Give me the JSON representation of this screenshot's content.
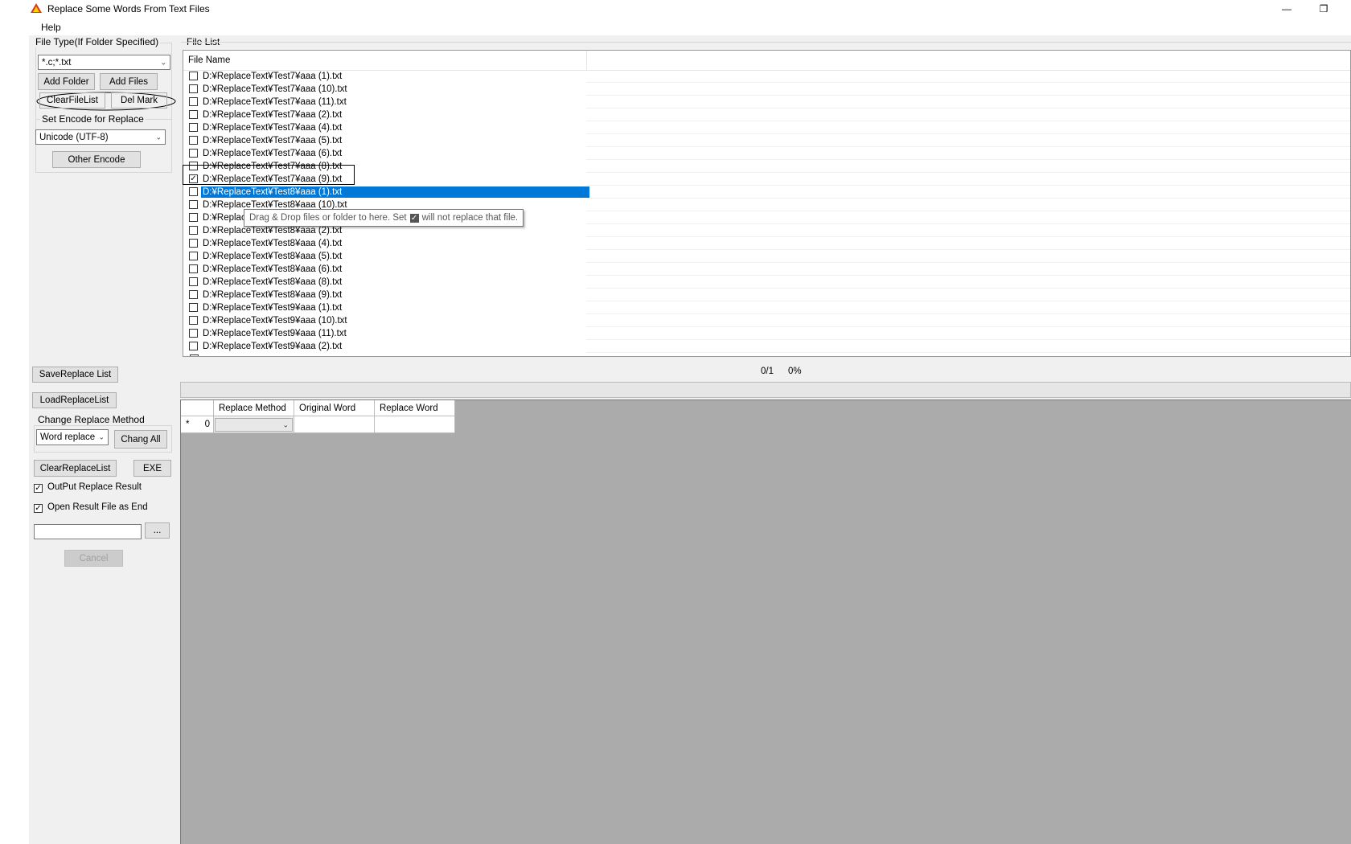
{
  "window": {
    "title": "Replace Some Words From Text Files",
    "minimize_glyph": "—",
    "restore_glyph": "❐"
  },
  "menu": {
    "help": "Help"
  },
  "left_panel": {
    "file_type_group": "File Type(If Folder Specified)",
    "file_type_value": "*.c;*.txt",
    "add_folder": "Add Folder",
    "add_files": "Add Files",
    "clear_file_list": "ClearFileList",
    "del_mark": "Del Mark",
    "encode_group": "Set Encode for Replace",
    "encode_value": "Unicode (UTF-8)",
    "other_encode": "Other Encode"
  },
  "file_list": {
    "group_label": "File List",
    "column_header": "File Name",
    "files": [
      {
        "name": "D:¥ReplaceText¥Test7¥aaa (1).txt",
        "checked": false
      },
      {
        "name": "D:¥ReplaceText¥Test7¥aaa (10).txt",
        "checked": false
      },
      {
        "name": "D:¥ReplaceText¥Test7¥aaa (11).txt",
        "checked": false
      },
      {
        "name": "D:¥ReplaceText¥Test7¥aaa (2).txt",
        "checked": false
      },
      {
        "name": "D:¥ReplaceText¥Test7¥aaa (4).txt",
        "checked": false
      },
      {
        "name": "D:¥ReplaceText¥Test7¥aaa (5).txt",
        "checked": false
      },
      {
        "name": "D:¥ReplaceText¥Test7¥aaa (6).txt",
        "checked": false
      },
      {
        "name": "D:¥ReplaceText¥Test7¥aaa (8).txt",
        "checked": false
      },
      {
        "name": "D:¥ReplaceText¥Test7¥aaa (9).txt",
        "checked": true
      },
      {
        "name": "D:¥ReplaceText¥Test8¥aaa (1).txt",
        "checked": false,
        "selected": true
      },
      {
        "name": "D:¥ReplaceText¥Test8¥aaa (10).txt",
        "checked": false
      },
      {
        "name": "D:¥Replace",
        "checked": false
      },
      {
        "name": "D:¥ReplaceText¥Test8¥aaa (2).txt",
        "checked": false
      },
      {
        "name": "D:¥ReplaceText¥Test8¥aaa (4).txt",
        "checked": false
      },
      {
        "name": "D:¥ReplaceText¥Test8¥aaa (5).txt",
        "checked": false
      },
      {
        "name": "D:¥ReplaceText¥Test8¥aaa (6).txt",
        "checked": false
      },
      {
        "name": "D:¥ReplaceText¥Test8¥aaa (8).txt",
        "checked": false
      },
      {
        "name": "D:¥ReplaceText¥Test8¥aaa (9).txt",
        "checked": false
      },
      {
        "name": "D:¥ReplaceText¥Test9¥aaa (1).txt",
        "checked": false
      },
      {
        "name": "D:¥ReplaceText¥Test9¥aaa (10).txt",
        "checked": false
      },
      {
        "name": "D:¥ReplaceText¥Test9¥aaa (11).txt",
        "checked": false
      },
      {
        "name": "D:¥ReplaceText¥Test9¥aaa (2).txt",
        "checked": false
      }
    ],
    "tooltip_before": "Drag & Drop files or folder to here. Set",
    "tooltip_after": "will not replace  that file."
  },
  "progress": {
    "count": "0/1",
    "percent": "0%"
  },
  "bottom_left": {
    "save_replace_list": "SaveReplace List",
    "load_replace_list": "LoadReplaceList",
    "change_method_group": "Change Replace Method",
    "method_value": "Word replace",
    "change_all": "Chang All",
    "clear_replace_list": "ClearReplaceList",
    "exe": "EXE",
    "output_result": "OutPut Replace Result",
    "output_result_checked": true,
    "open_result": "Open Result File as End",
    "open_result_checked": true,
    "path_value": "",
    "browse": "...",
    "cancel": "Cancel"
  },
  "replace_grid": {
    "columns": [
      "",
      "Replace Method",
      "Original Word",
      "Replace Word"
    ],
    "new_row_marker": "*",
    "new_row_index": "0"
  }
}
